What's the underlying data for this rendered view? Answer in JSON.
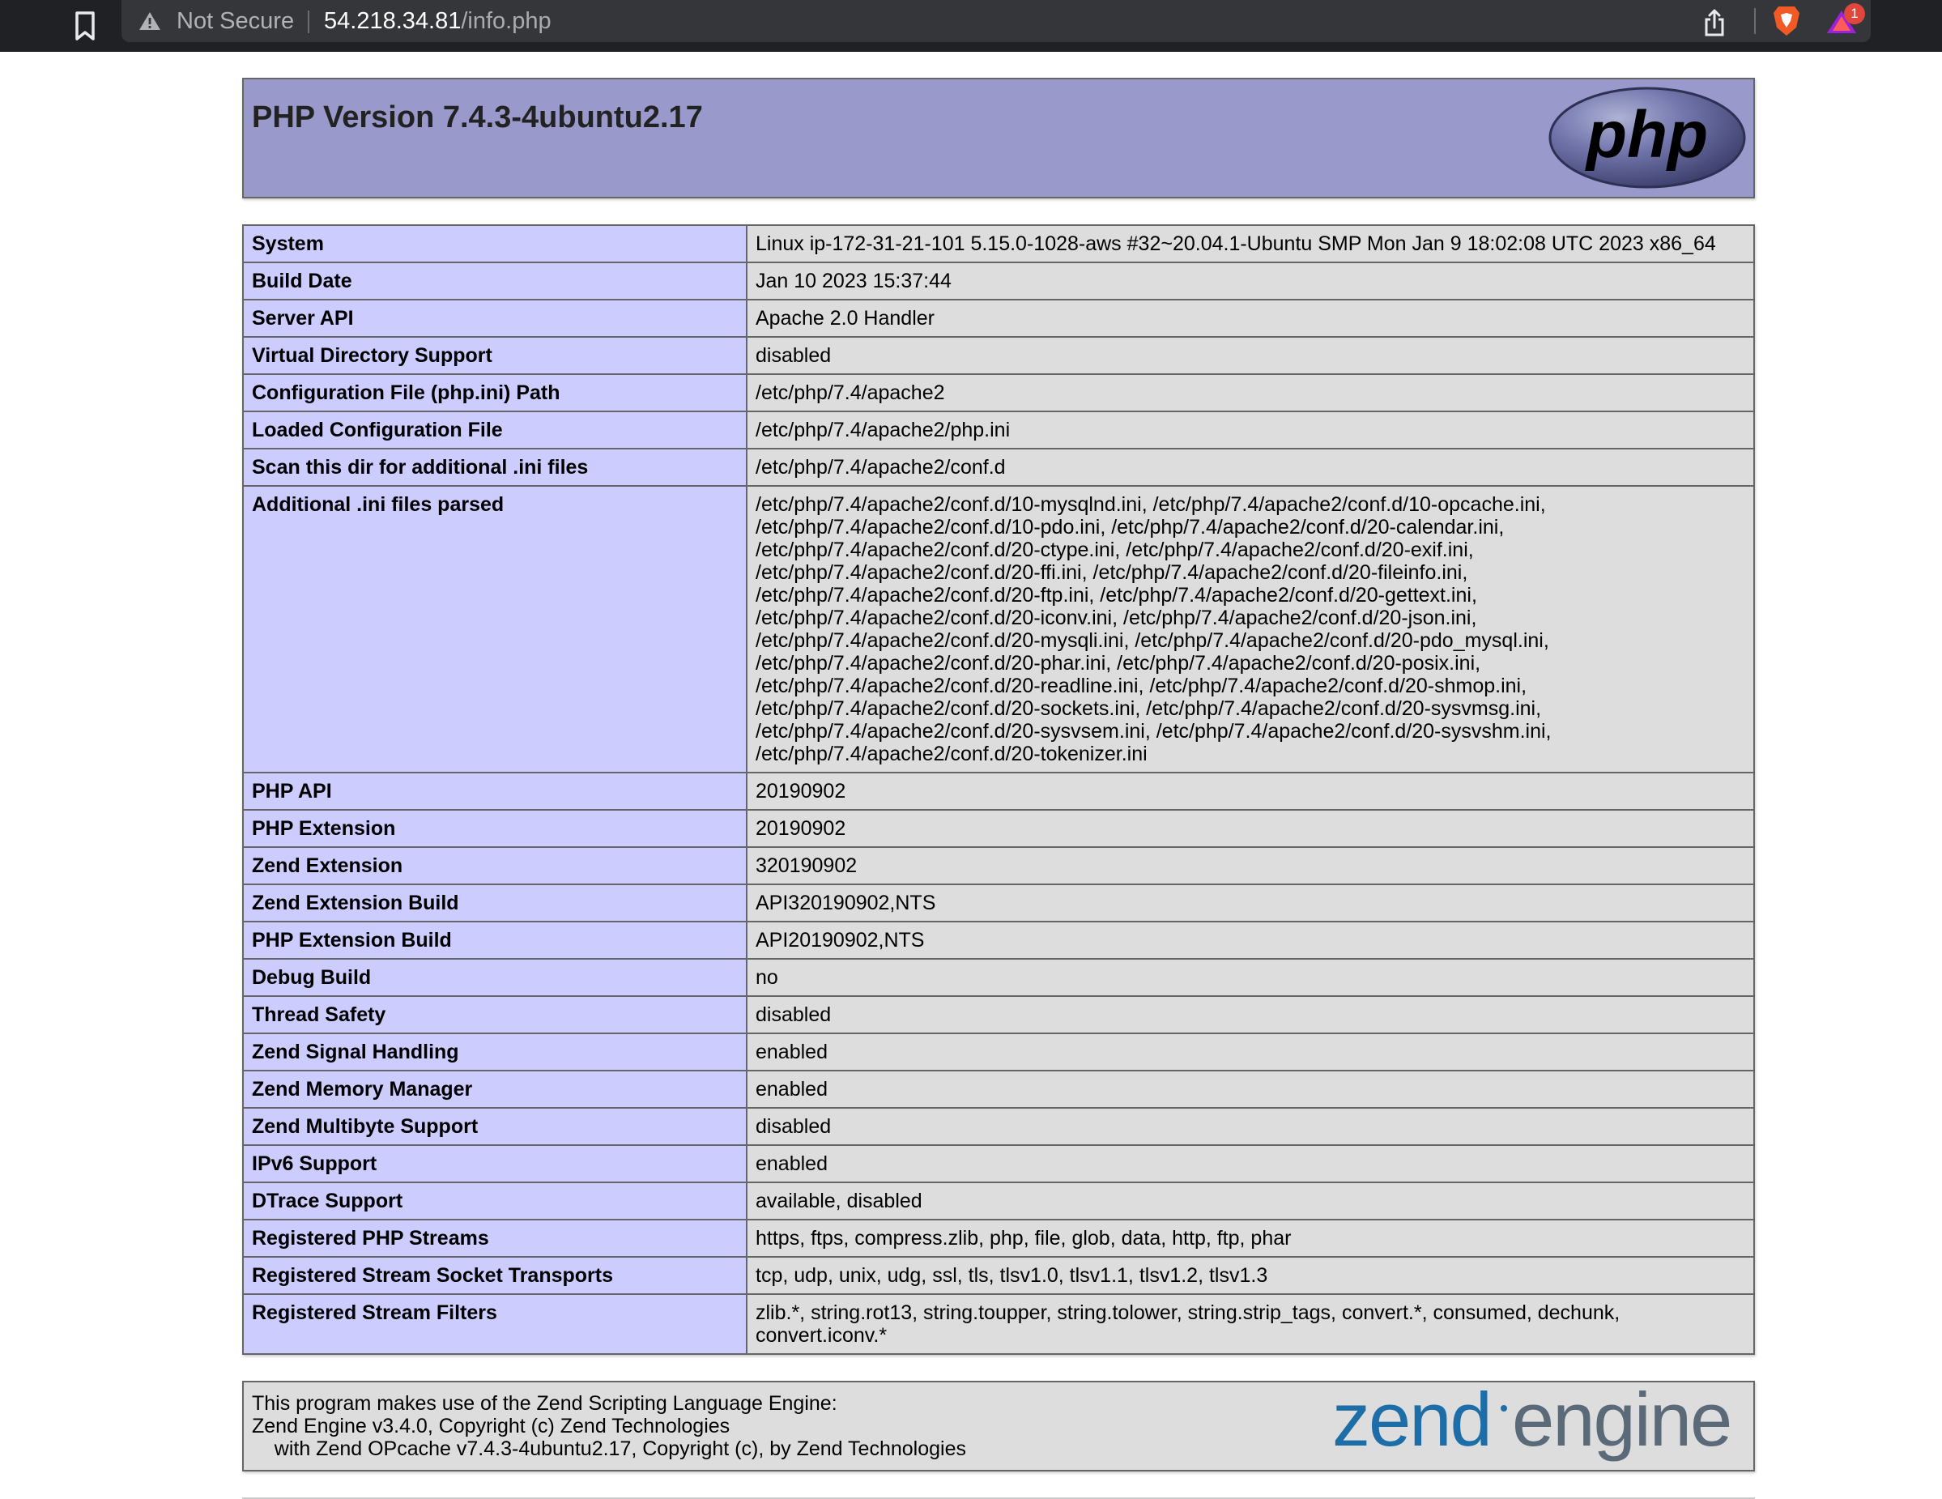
{
  "browser": {
    "not_secure_label": "Not Secure",
    "url_host": "54.218.34.81",
    "url_path": "/info.php",
    "badge_count": "1"
  },
  "header": {
    "title": "PHP Version 7.4.3-4ubuntu2.17",
    "logo_text": "php"
  },
  "info_rows": [
    {
      "key": "System",
      "value": "Linux ip-172-31-21-101 5.15.0-1028-aws #32~20.04.1-Ubuntu SMP Mon Jan 9 18:02:08 UTC 2023 x86_64"
    },
    {
      "key": "Build Date",
      "value": "Jan 10 2023 15:37:44"
    },
    {
      "key": "Server API",
      "value": "Apache 2.0 Handler"
    },
    {
      "key": "Virtual Directory Support",
      "value": "disabled"
    },
    {
      "key": "Configuration File (php.ini) Path",
      "value": "/etc/php/7.4/apache2"
    },
    {
      "key": "Loaded Configuration File",
      "value": "/etc/php/7.4/apache2/php.ini"
    },
    {
      "key": "Scan this dir for additional .ini files",
      "value": "/etc/php/7.4/apache2/conf.d"
    },
    {
      "key": "Additional .ini files parsed",
      "value": "/etc/php/7.4/apache2/conf.d/10-mysqlnd.ini, /etc/php/7.4/apache2/conf.d/10-opcache.ini, /etc/php/7.4/apache2/conf.d/10-pdo.ini, /etc/php/7.4/apache2/conf.d/20-calendar.ini, /etc/php/7.4/apache2/conf.d/20-ctype.ini, /etc/php/7.4/apache2/conf.d/20-exif.ini, /etc/php/7.4/apache2/conf.d/20-ffi.ini, /etc/php/7.4/apache2/conf.d/20-fileinfo.ini, /etc/php/7.4/apache2/conf.d/20-ftp.ini, /etc/php/7.4/apache2/conf.d/20-gettext.ini, /etc/php/7.4/apache2/conf.d/20-iconv.ini, /etc/php/7.4/apache2/conf.d/20-json.ini, /etc/php/7.4/apache2/conf.d/20-mysqli.ini, /etc/php/7.4/apache2/conf.d/20-pdo_mysql.ini, /etc/php/7.4/apache2/conf.d/20-phar.ini, /etc/php/7.4/apache2/conf.d/20-posix.ini, /etc/php/7.4/apache2/conf.d/20-readline.ini, /etc/php/7.4/apache2/conf.d/20-shmop.ini, /etc/php/7.4/apache2/conf.d/20-sockets.ini, /etc/php/7.4/apache2/conf.d/20-sysvmsg.ini, /etc/php/7.4/apache2/conf.d/20-sysvsem.ini, /etc/php/7.4/apache2/conf.d/20-sysvshm.ini, /etc/php/7.4/apache2/conf.d/20-tokenizer.ini"
    },
    {
      "key": "PHP API",
      "value": "20190902"
    },
    {
      "key": "PHP Extension",
      "value": "20190902"
    },
    {
      "key": "Zend Extension",
      "value": "320190902"
    },
    {
      "key": "Zend Extension Build",
      "value": "API320190902,NTS"
    },
    {
      "key": "PHP Extension Build",
      "value": "API20190902,NTS"
    },
    {
      "key": "Debug Build",
      "value": "no"
    },
    {
      "key": "Thread Safety",
      "value": "disabled"
    },
    {
      "key": "Zend Signal Handling",
      "value": "enabled"
    },
    {
      "key": "Zend Memory Manager",
      "value": "enabled"
    },
    {
      "key": "Zend Multibyte Support",
      "value": "disabled"
    },
    {
      "key": "IPv6 Support",
      "value": "enabled"
    },
    {
      "key": "DTrace Support",
      "value": "available, disabled"
    },
    {
      "key": "Registered PHP Streams",
      "value": "https, ftps, compress.zlib, php, file, glob, data, http, ftp, phar"
    },
    {
      "key": "Registered Stream Socket Transports",
      "value": "tcp, udp, unix, udg, ssl, tls, tlsv1.0, tlsv1.1, tlsv1.2, tlsv1.3"
    },
    {
      "key": "Registered Stream Filters",
      "value": "zlib.*, string.rot13, string.toupper, string.tolower, string.strip_tags, convert.*, consumed, dechunk, convert.iconv.*"
    }
  ],
  "footer": {
    "lines": [
      "This program makes use of the Zend Scripting Language Engine:",
      "Zend Engine v3.4.0, Copyright (c) Zend Technologies",
      "    with Zend OPcache v7.4.3-4ubuntu2.17, Copyright (c), by Zend Technologies"
    ],
    "logo_word1": "zend",
    "logo_word2": "engine"
  },
  "colors": {
    "header_bg": "#9999cc",
    "key_bg": "#ccccff",
    "value_bg": "#dddddd",
    "border": "#666666",
    "chrome_bg": "#202124"
  }
}
